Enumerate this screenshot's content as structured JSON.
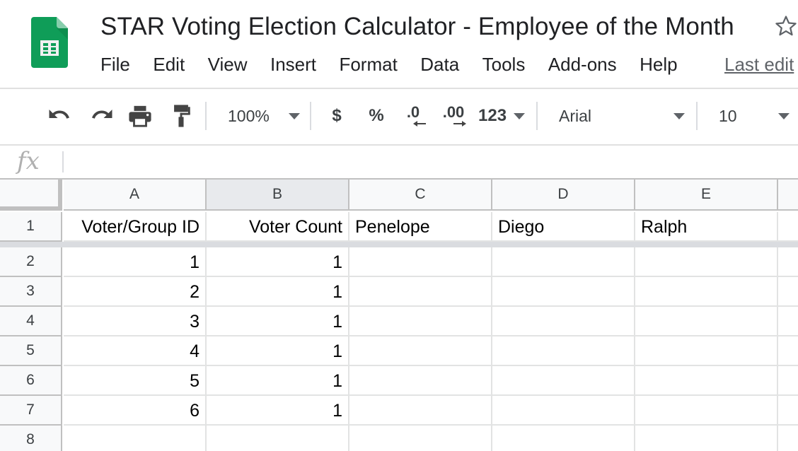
{
  "app": {
    "title": "STAR Voting Election Calculator - Employee of the Month",
    "brand_color": "#0f9d58",
    "menu": [
      "File",
      "Edit",
      "View",
      "Insert",
      "Format",
      "Data",
      "Tools",
      "Add-ons",
      "Help"
    ],
    "last_edit": "Last edit"
  },
  "toolbar": {
    "undo_icon": "undo-icon",
    "redo_icon": "redo-icon",
    "print_icon": "print-icon",
    "paint_format_icon": "paint-format-icon",
    "zoom": "100%",
    "currency": "$",
    "percent": "%",
    "decrease_decimal": ".0",
    "increase_decimal": ".00",
    "more_formats": "123",
    "font": "Arial",
    "font_size": "10"
  },
  "formula_bar": {
    "label": "fx",
    "value": ""
  },
  "sheet": {
    "columns": [
      "A",
      "B",
      "C",
      "D",
      "E"
    ],
    "rows": [
      "1",
      "2",
      "3",
      "4",
      "5",
      "6",
      "7",
      "8"
    ],
    "header": [
      "Voter/Group ID",
      "Voter Count",
      "Penelope",
      "Diego",
      "Ralph"
    ],
    "data": [
      [
        "1",
        "1",
        "",
        "",
        ""
      ],
      [
        "2",
        "1",
        "",
        "",
        ""
      ],
      [
        "3",
        "1",
        "",
        "",
        ""
      ],
      [
        "4",
        "1",
        "",
        "",
        ""
      ],
      [
        "5",
        "1",
        "",
        "",
        ""
      ],
      [
        "6",
        "1",
        "",
        "",
        ""
      ],
      [
        "",
        "",
        "",
        "",
        ""
      ]
    ]
  }
}
